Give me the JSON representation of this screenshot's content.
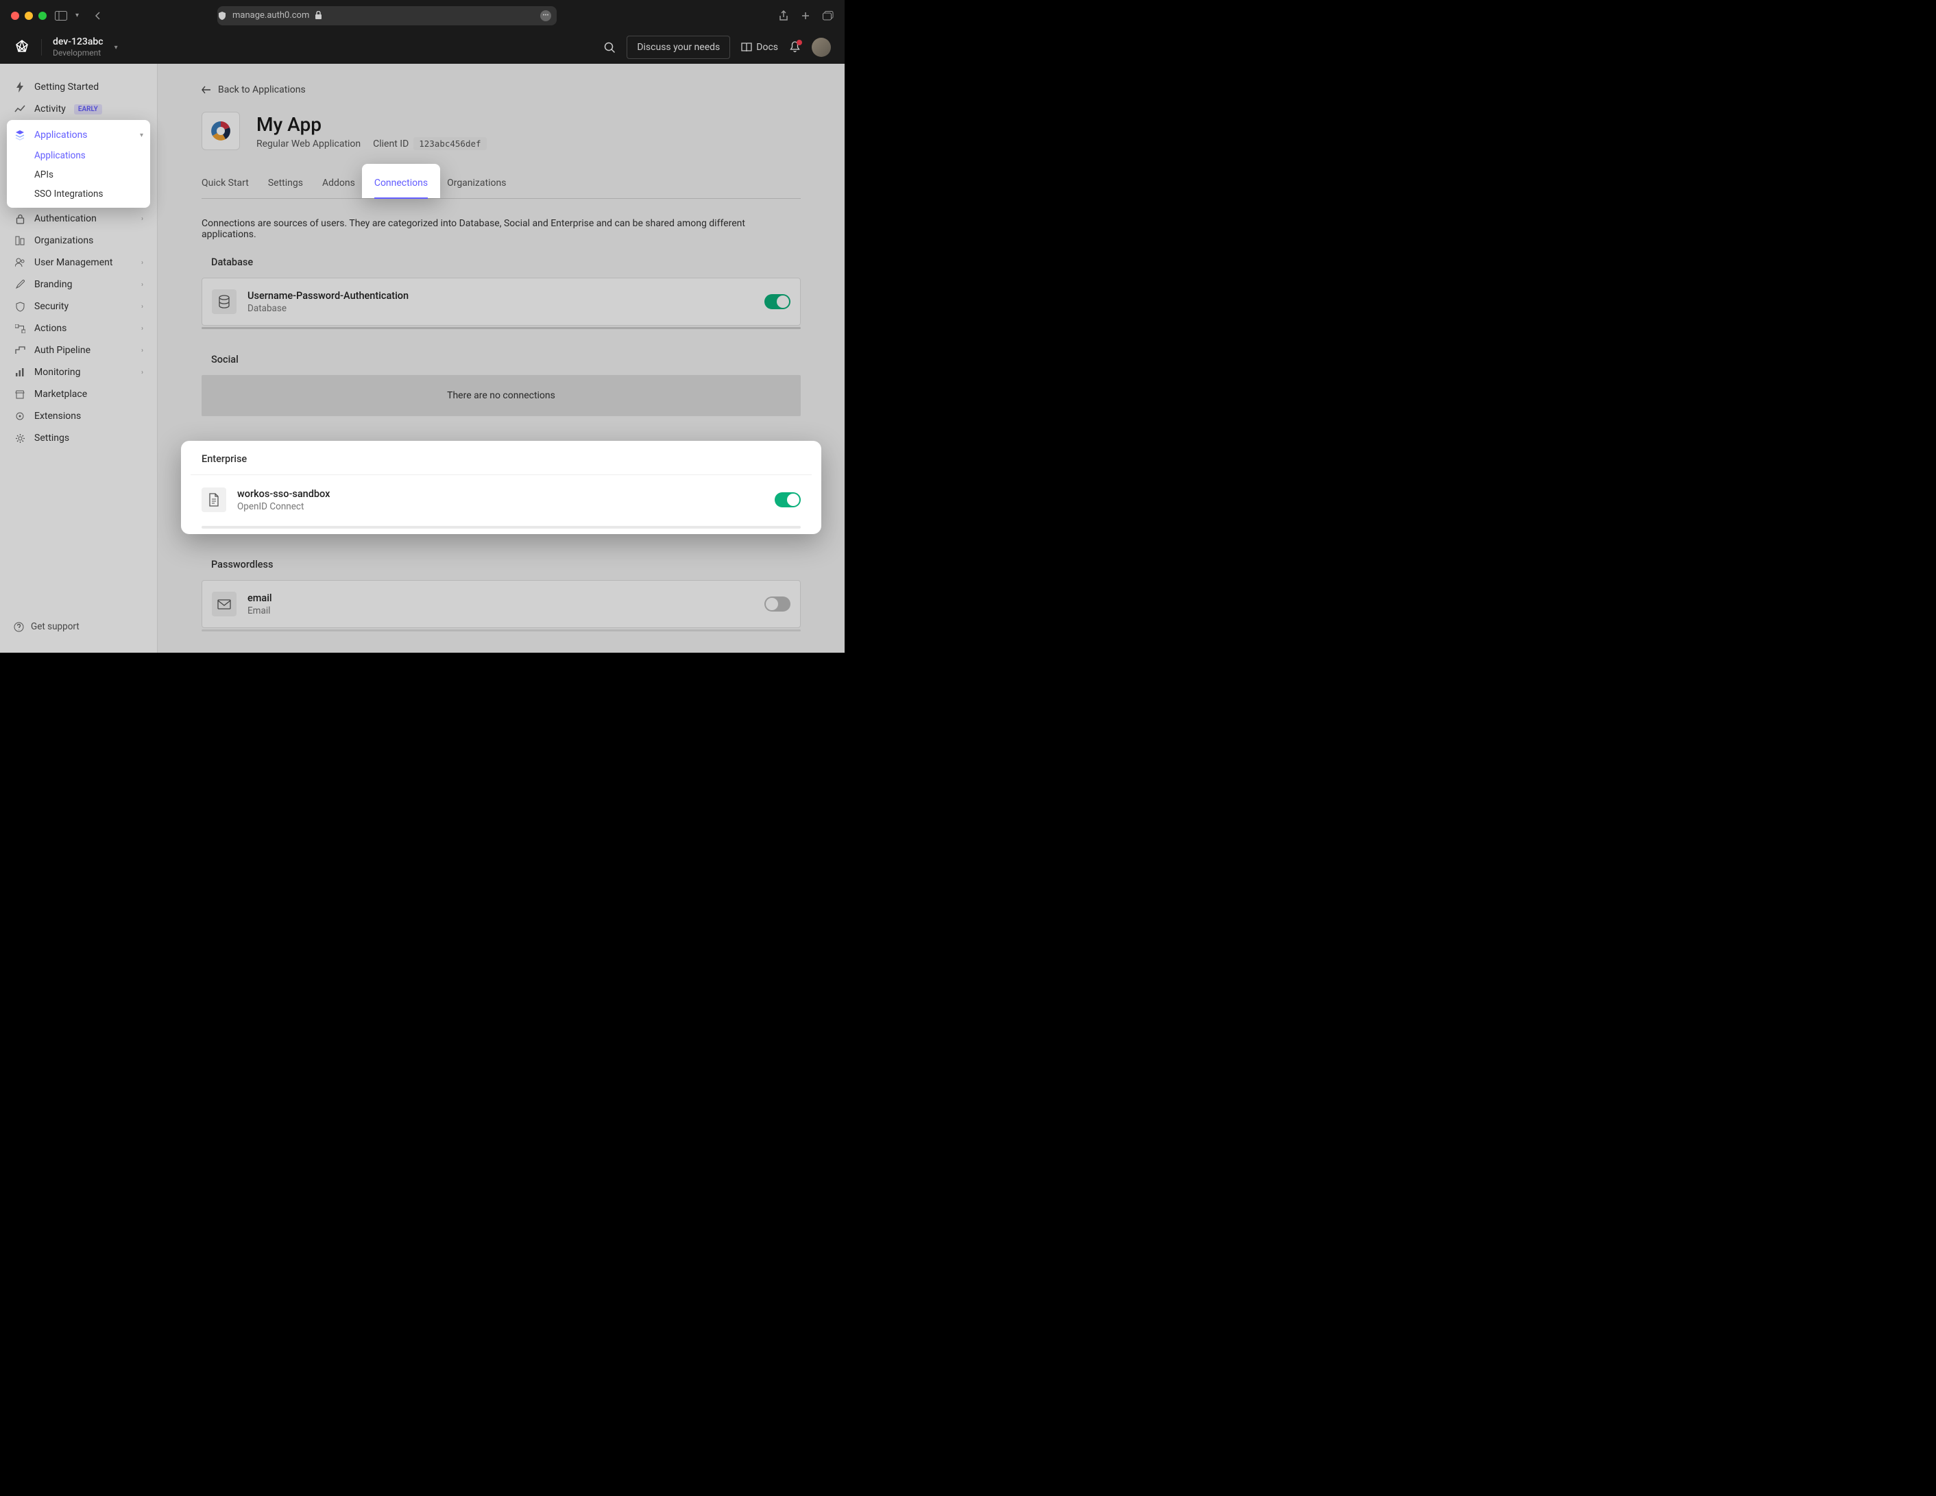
{
  "browser": {
    "url": "manage.auth0.com"
  },
  "header": {
    "tenant_name": "dev-123abc",
    "tenant_env": "Development",
    "discuss_label": "Discuss your needs",
    "docs_label": "Docs"
  },
  "sidebar": {
    "items": [
      {
        "label": "Getting Started"
      },
      {
        "label": "Activity",
        "badge": "EARLY"
      },
      {
        "label": "Applications",
        "active": true,
        "children": [
          {
            "label": "Applications",
            "active": true
          },
          {
            "label": "APIs"
          },
          {
            "label": "SSO Integrations"
          }
        ]
      },
      {
        "label": "Authentication"
      },
      {
        "label": "Organizations"
      },
      {
        "label": "User Management"
      },
      {
        "label": "Branding"
      },
      {
        "label": "Security"
      },
      {
        "label": "Actions"
      },
      {
        "label": "Auth Pipeline"
      },
      {
        "label": "Monitoring"
      },
      {
        "label": "Marketplace"
      },
      {
        "label": "Extensions"
      },
      {
        "label": "Settings"
      }
    ],
    "support_label": "Get support"
  },
  "main": {
    "back_label": "Back to Applications",
    "app_title": "My App",
    "app_type": "Regular Web Application",
    "client_id_label": "Client ID",
    "client_id_value": "123abc456def",
    "tabs": [
      {
        "label": "Quick Start"
      },
      {
        "label": "Settings"
      },
      {
        "label": "Addons"
      },
      {
        "label": "Connections",
        "active": true
      },
      {
        "label": "Organizations"
      }
    ],
    "intro": "Connections are sources of users. They are categorized into Database, Social and Enterprise and can be shared among different applications.",
    "sections": {
      "database": {
        "title": "Database",
        "connections": [
          {
            "name": "Username-Password-Authentication",
            "type": "Database",
            "on": true
          }
        ]
      },
      "social": {
        "title": "Social",
        "empty": "There are no connections"
      },
      "enterprise": {
        "title": "Enterprise",
        "connections": [
          {
            "name": "workos-sso-sandbox",
            "type": "OpenID Connect",
            "on": true
          }
        ]
      },
      "passwordless": {
        "title": "Passwordless",
        "connections": [
          {
            "name": "email",
            "type": "Email",
            "on": false
          }
        ]
      }
    }
  }
}
